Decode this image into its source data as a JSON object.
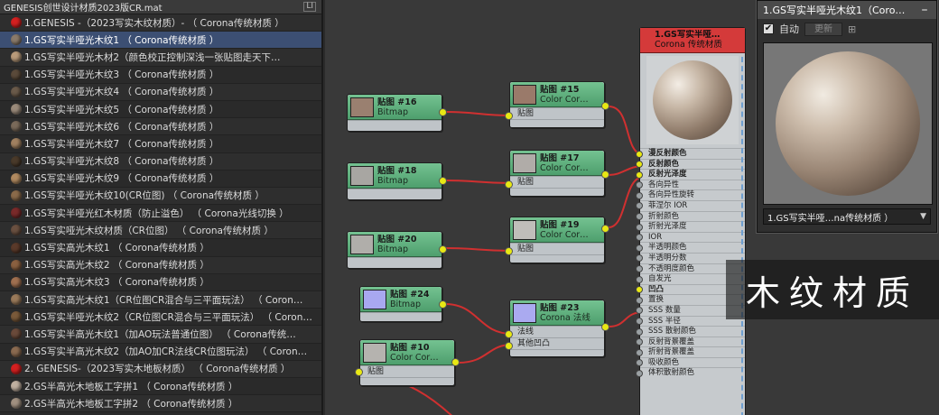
{
  "browser": {
    "title": "GENESIS创世设计材质2023版CR.mat",
    "pin_label": "LI",
    "items": [
      {
        "label": "1.GENESIS  -（2023写实木纹材质）-  （ Corona传统材质 ）",
        "swatch": "#d42020",
        "selected": false
      },
      {
        "label": "1.GS写实半哑光木纹1  （ Corona传统材质 ）",
        "swatch": "#8a7a6a",
        "selected": true
      },
      {
        "label": "1.GS写实半哑光木材2（颜色校正控制深浅一张贴图走天下…",
        "swatch": "#b89a7a",
        "selected": false
      },
      {
        "label": "1.GS写实半哑光木纹3  （ Corona传统材质 ）",
        "swatch": "#5a4a3a",
        "selected": false
      },
      {
        "label": "1.GS写实半哑光木纹4  （ Corona传统材质 ）",
        "swatch": "#6a5a4a",
        "selected": false
      },
      {
        "label": "1.GS写实半哑光木纹5  （ Corona传统材质 ）",
        "swatch": "#9a8a7a",
        "selected": false
      },
      {
        "label": "1.GS写实半哑光木纹6  （ Corona传统材质 ）",
        "swatch": "#7a6a5a",
        "selected": false
      },
      {
        "label": "1.GS写实半哑光木纹7  （ Corona传统材质 ）",
        "swatch": "#a08060",
        "selected": false
      },
      {
        "label": "1.GS写实半哑光木纹8  （ Corona传统材质 ）",
        "swatch": "#4a3a2a",
        "selected": false
      },
      {
        "label": "1.GS写实半哑光木纹9  （ Corona传统材质 ）",
        "swatch": "#b08a60",
        "selected": false
      },
      {
        "label": "1.GS写实半哑光木纹10(CR位图)  （ Corona传统材质 ）",
        "swatch": "#8a6a4a",
        "selected": false
      },
      {
        "label": "1.GS写实半哑光红木材质（防止溢色）  （ Corona光线切换 ）",
        "swatch": "#7a2a2a",
        "selected": false
      },
      {
        "label": "1.GS写实哑光木纹材质（CR位图）  （ Corona传统材质 ）",
        "swatch": "#6a5040",
        "selected": false
      },
      {
        "label": "1.GS写实高光木纹1  （ Corona传统材质 ）",
        "swatch": "#5a3a2a",
        "selected": false
      },
      {
        "label": "1.GS写实高光木纹2  （ Corona传统材质 ）",
        "swatch": "#8a6040",
        "selected": false
      },
      {
        "label": "1.GS写实高光木纹3  （ Corona传统材质 ）",
        "swatch": "#a07050",
        "selected": false
      },
      {
        "label": "1.GS写实高光木纹1（CR位图CR混合与三平面玩法）  （ Coron…",
        "swatch": "#9a7a5a",
        "selected": false
      },
      {
        "label": "1.GS写实半哑光木纹2（CR位图CR混合与三平面玩法）  （ Coron…",
        "swatch": "#7a5a3a",
        "selected": false
      },
      {
        "label": "1.GS写实半高光木纹1（加AO玩法普通位图）  （ Corona传统…",
        "swatch": "#6a4a3a",
        "selected": false
      },
      {
        "label": "1.GS写实半高光木纹2（加AO加CR法线CR位图玩法）  （ Coron…",
        "swatch": "#8a6a50",
        "selected": false
      },
      {
        "label": "2. GENESIS-（2023写实木地板材质）  （ Corona传统材质 ）",
        "swatch": "#d42020",
        "selected": false
      },
      {
        "label": "2.GS半高光木地板工字拼1  （ Corona传统材质 ）",
        "swatch": "#c0b0a0",
        "selected": false
      },
      {
        "label": "2.GS半高光木地板工字拼2  （ Corona传统材质 ）",
        "swatch": "#a09080",
        "selected": false
      }
    ]
  },
  "nodes": [
    {
      "id": "n16",
      "title": "贴图 #16",
      "sub": "Bitmap",
      "row": "",
      "thumb": "#9a8070"
    },
    {
      "id": "n18",
      "title": "贴图 #18",
      "sub": "Bitmap",
      "row": "",
      "thumb": "#a8a6a2"
    },
    {
      "id": "n20",
      "title": "贴图 #20",
      "sub": "Bitmap",
      "row": "",
      "thumb": "#b0aeaa"
    },
    {
      "id": "n24",
      "title": "贴图 #24",
      "sub": "Bitmap",
      "row": "",
      "thumb": "#a8a8f0"
    },
    {
      "id": "n10",
      "title": "贴图 #10",
      "sub": "Color Cor…",
      "row": "贴图",
      "thumb": "#b5b3af"
    },
    {
      "id": "n15",
      "title": "贴图 #15",
      "sub": "Color Cor…",
      "row": "贴图",
      "thumb": "#9a7a6a"
    },
    {
      "id": "n17",
      "title": "贴图 #17",
      "sub": "Color Cor…",
      "row": "贴图",
      "thumb": "#b0aca8"
    },
    {
      "id": "n19",
      "title": "贴图 #19",
      "sub": "Color Cor…",
      "row": "贴图",
      "thumb": "#c0beba"
    },
    {
      "id": "n23",
      "title": "贴图 #23",
      "sub": "Corona 法线",
      "row": "法线",
      "row2": "其他凹凸",
      "thumb": "#aaaaf0"
    }
  ],
  "main_node": {
    "title": "1.GS写实半哑…",
    "subtitle": "Corona 传统材质",
    "slots": [
      "漫反射颜色",
      "反射颜色",
      "反射光泽度",
      "各向异性",
      "各向异性旋转",
      "菲涅尔 IOR",
      "折射颜色",
      "折射光泽度",
      "IOR",
      "半透明颜色",
      "半透明分数",
      "不透明度颜色",
      "自发光",
      "凹凸",
      "置换",
      "SSS 数量",
      "SSS 半径",
      "SSS 散射颜色",
      "反射背景覆盖",
      "折射背景覆盖",
      "吸收颜色",
      "体积散射颜色"
    ]
  },
  "preview": {
    "title": "1.GS写实半哑光木纹1（Coro…",
    "auto_label": "自动",
    "update_label": "更新",
    "select_value": "1.GS写实半哑…na传统材质 ）"
  },
  "caption": "木纹材质"
}
